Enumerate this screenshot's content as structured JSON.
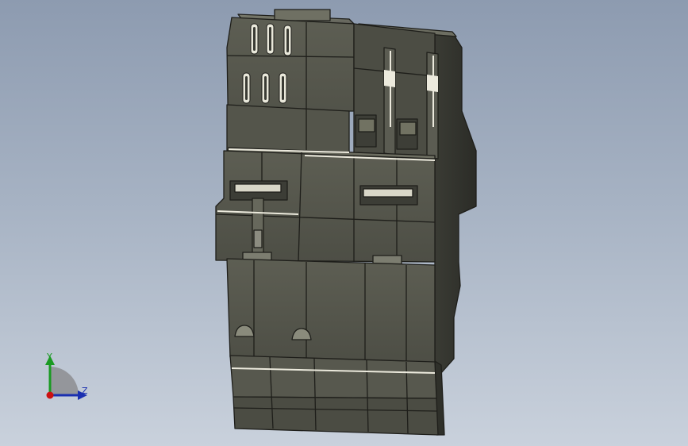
{
  "viewport": {
    "background_top": "#8d9bb0",
    "background_bottom": "#c9d1dc"
  },
  "model": {
    "body_color": "#55564c",
    "highlight_color": "#eceadd",
    "edge_color": "#1e1e1a"
  },
  "triad": {
    "y_label": "Y",
    "z_label": "Z",
    "y_color": "#1a9a22",
    "z_color": "#1a2fb0",
    "x_color": "#cc1111"
  }
}
